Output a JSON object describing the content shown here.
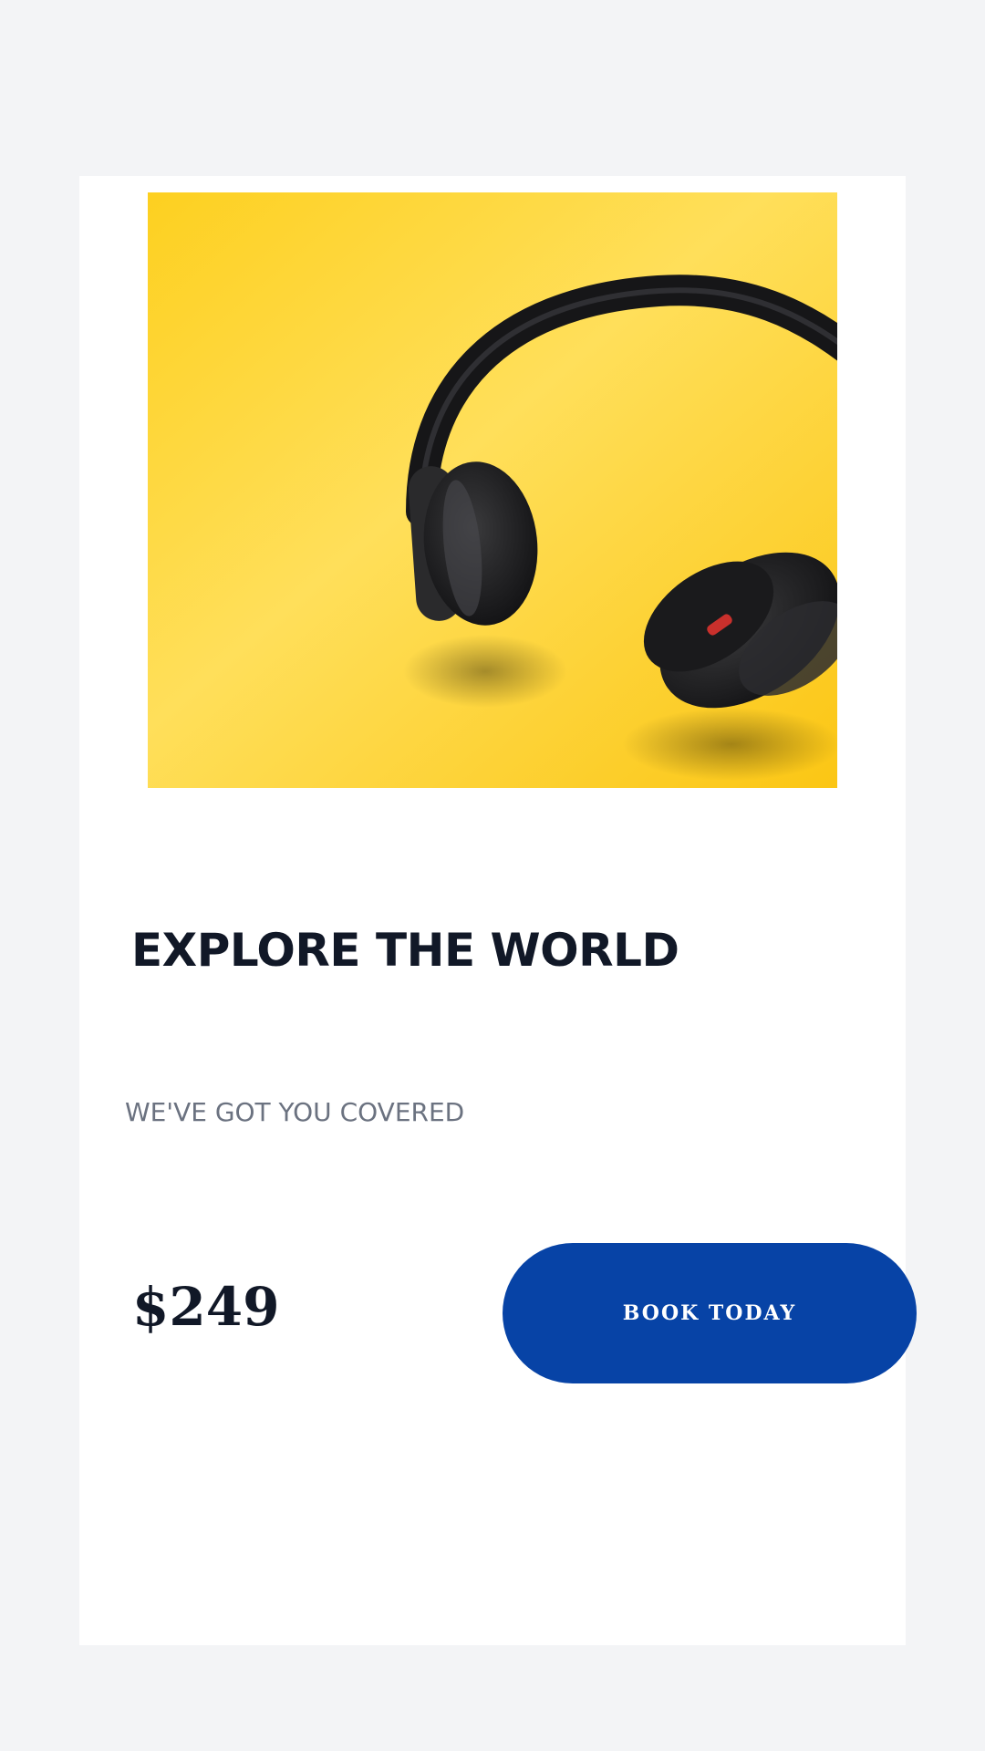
{
  "card": {
    "image": {
      "subject": "over-ear headphones on yellow background",
      "background_color": "#fcca1c",
      "accent_color": "#1c1c1e"
    },
    "title": "EXPLORE THE WORLD",
    "subtitle": "WE'VE GOT YOU COVERED",
    "price": "$249",
    "cta_label": "BOOK TODAY"
  },
  "colors": {
    "page_background": "#f3f4f6",
    "card_background": "#ffffff",
    "title": "#111827",
    "subtitle": "#6b7280",
    "button": "#0743a6",
    "button_text": "#ffffff"
  }
}
